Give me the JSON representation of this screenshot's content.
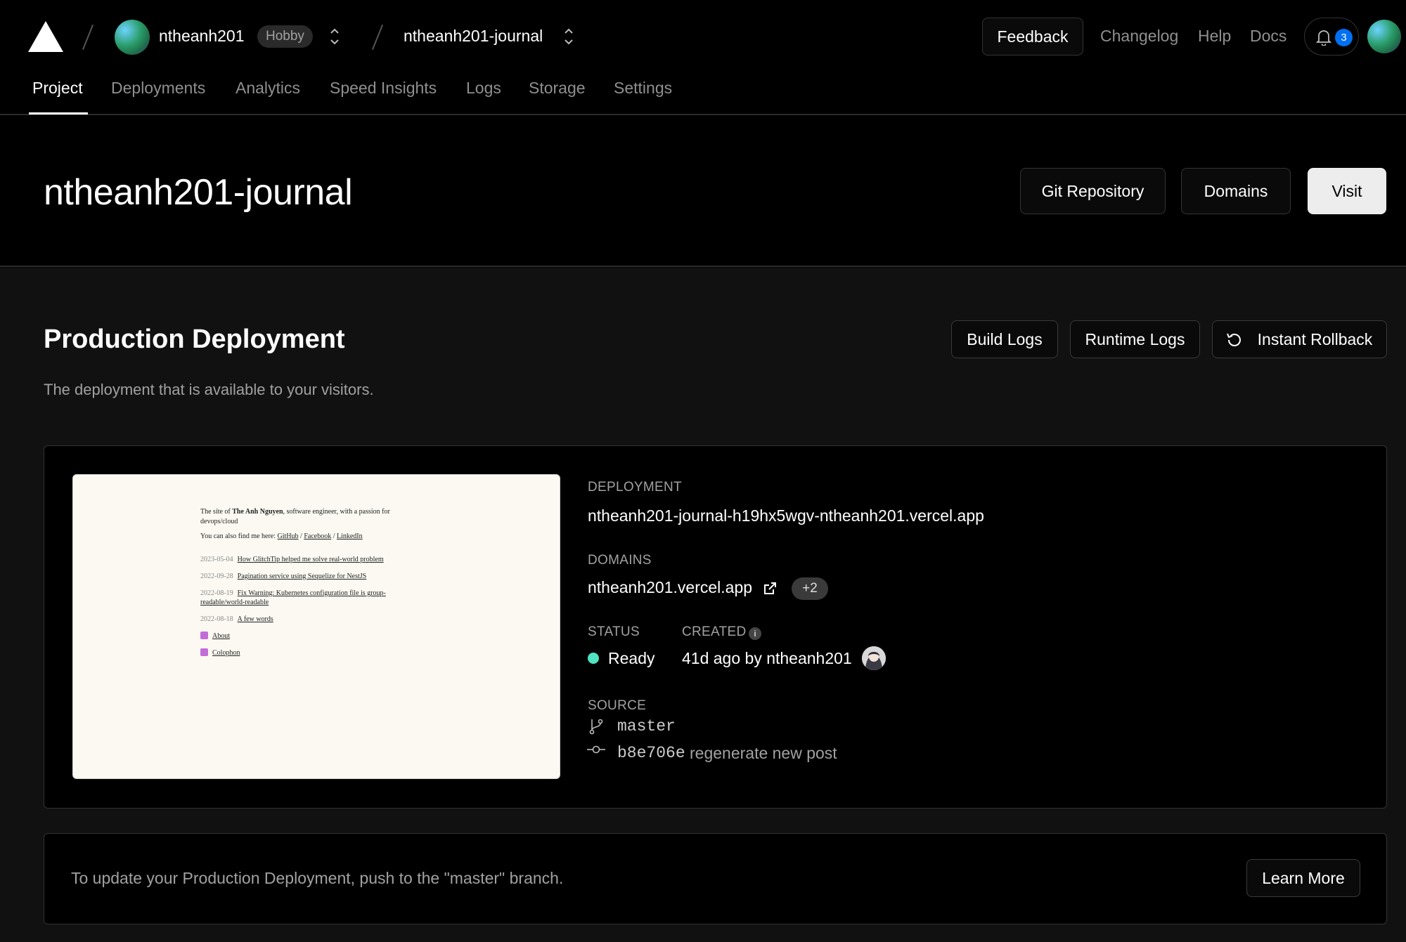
{
  "topbar": {
    "team_name": "ntheanh201",
    "plan_badge": "Hobby",
    "project_name": "ntheanh201-journal",
    "feedback_label": "Feedback",
    "links": [
      "Changelog",
      "Help",
      "Docs"
    ],
    "notification_count": "3"
  },
  "tabs": [
    "Project",
    "Deployments",
    "Analytics",
    "Speed Insights",
    "Logs",
    "Storage",
    "Settings"
  ],
  "active_tab": "Project",
  "header": {
    "title": "ntheanh201-journal",
    "git_repository_label": "Git Repository",
    "domains_label": "Domains",
    "visit_label": "Visit"
  },
  "production": {
    "title": "Production Deployment",
    "subtitle": "The deployment that is available to your visitors.",
    "build_logs_label": "Build Logs",
    "runtime_logs_label": "Runtime Logs",
    "instant_rollback_label": "Instant Rollback"
  },
  "preview": {
    "intro_prefix": "The site of ",
    "intro_name": "The Anh Nguyen",
    "intro_suffix": ", software engineer, with a passion for devops/cloud",
    "find_text": "You can also find me here: ",
    "social": [
      "GitHub",
      "Facebook",
      "LinkedIn"
    ],
    "posts": [
      {
        "date": "2023-05-04",
        "title": "How GlitchTip helped me solve real-world problem"
      },
      {
        "date": "2022-09-28",
        "title": "Pagination service using Sequelize for NestJS"
      },
      {
        "date": "2022-08-19",
        "title": "Fix Warning: Kubernetes configuration file is group-readable/world-readable"
      },
      {
        "date": "2022-08-18",
        "title": "A few words"
      }
    ],
    "nav": [
      "About",
      "Colophon"
    ]
  },
  "deployment": {
    "deployment_label": "DEPLOYMENT",
    "deployment_url": "ntheanh201-journal-h19hx5wgv-ntheanh201.vercel.app",
    "domains_label": "DOMAINS",
    "domain": "ntheanh201.vercel.app",
    "extra_domains": "+2",
    "status_label": "STATUS",
    "status": "Ready",
    "status_color": "#50e3c2",
    "created_label": "CREATED",
    "created": "41d ago by ntheanh201",
    "source_label": "SOURCE",
    "branch": "master",
    "commit_hash": "b8e706e",
    "commit_message": "regenerate new post"
  },
  "footer_note": {
    "text": "To update your Production Deployment, push to the \"master\" branch.",
    "learn_more_label": "Learn More"
  },
  "colors": {
    "accent_blue": "#0070f3",
    "background": "#0a0a0a"
  }
}
